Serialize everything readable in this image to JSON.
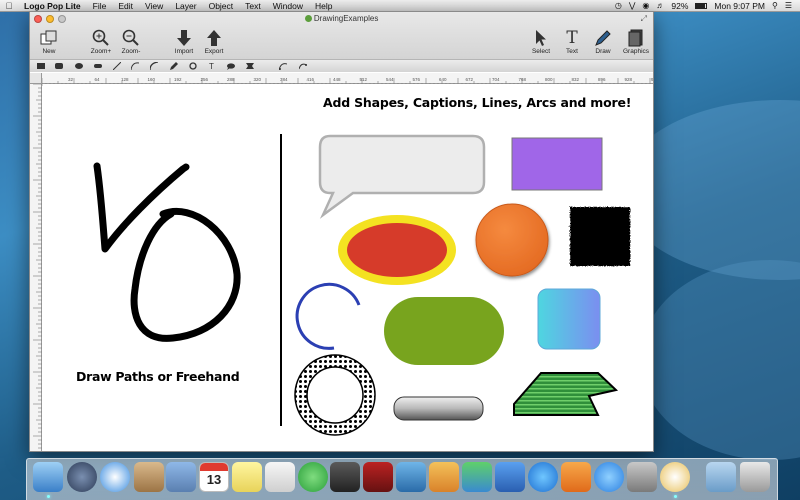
{
  "menubar": {
    "app_name": "Logo Pop Lite",
    "items": [
      "File",
      "Edit",
      "View",
      "Layer",
      "Object",
      "Text",
      "Window",
      "Help"
    ],
    "battery": "92%",
    "clock": "Mon 9:07 PM"
  },
  "window": {
    "title": "DrawingExamples"
  },
  "toolbar": {
    "new_label": "New",
    "zoom_in_label": "Zoom+",
    "zoom_out_label": "Zoom-",
    "import_label": "Import",
    "export_label": "Export",
    "select_label": "Select",
    "text_label": "Text",
    "draw_label": "Draw",
    "graphics_label": "Graphics"
  },
  "ruler": {
    "ticks": [
      "32",
      "64",
      "128",
      "160",
      "192",
      "256",
      "288",
      "320",
      "384",
      "416",
      "448",
      "512",
      "544",
      "576",
      "640",
      "672",
      "704",
      "768",
      "800",
      "832",
      "896",
      "928",
      "960"
    ]
  },
  "canvas": {
    "heading": "Add Shapes, Captions, Lines, Arcs and more!",
    "caption_left": "Draw Paths or Freehand"
  },
  "colors": {
    "speech_bubble_fill": "#ececec",
    "speech_bubble_stroke": "#b0b0b0",
    "purple_rect": "#a066e8",
    "ellipse_outer": "#f4e221",
    "ellipse_inner": "#d63b2a",
    "orange_circle": "#f27a2f",
    "black_square": "#000000",
    "blue_arc": "#2b3fb3",
    "green_pill": "#78a41e",
    "teal_square": "#4ed6e0",
    "banner_green": "#2f8f3a",
    "menubar_bg": "#e6e6e6"
  }
}
